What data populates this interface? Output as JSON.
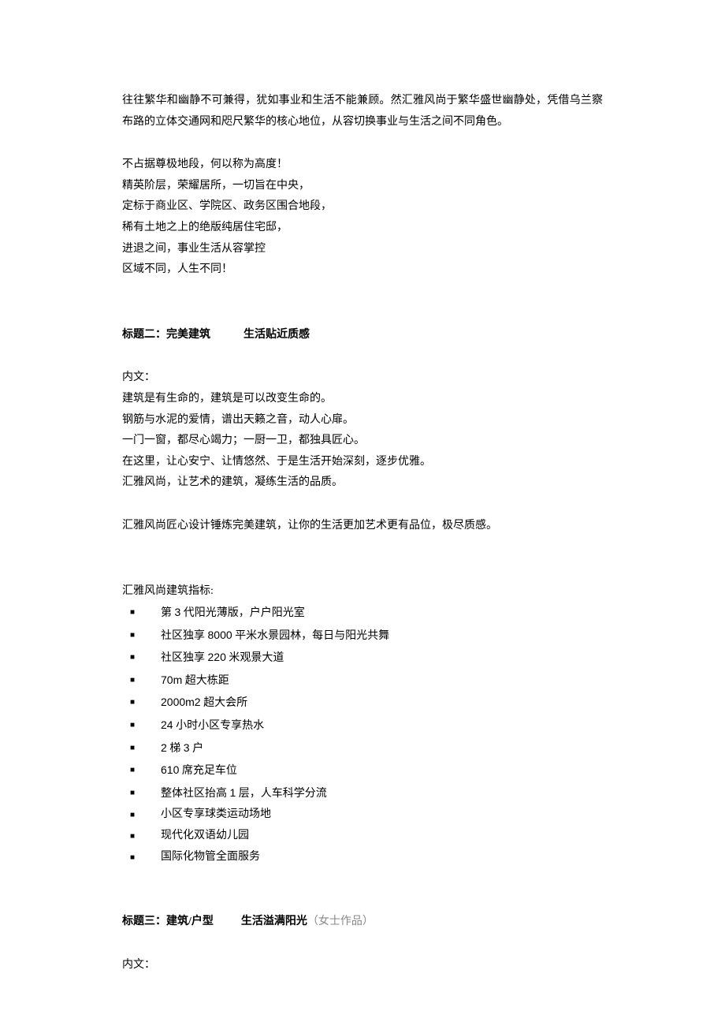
{
  "p1": "往往繁华和幽静不可兼得，犹如事业和生活不能兼顾。然汇雅风尚于繁华盛世幽静处，凭借乌兰察布路的立体交通网和咫尺繁华的核心地位，从容切换事业与生活之间不同角色。",
  "p2_lines": [
    "不占据尊极地段，何以称为高度！",
    "精英阶层，荣耀居所，一切旨在中央，",
    "定标于商业区、学院区、政务区围合地段，",
    "稀有土地之上的绝版纯居住宅邸，",
    "进退之间，事业生活从容掌控",
    "区域不同，人生不同！"
  ],
  "h2": {
    "prefix": "标题二：完美建筑",
    "suffix": "生活贴近质感"
  },
  "s2_lead": "内文：",
  "s2_lines": [
    "建筑是有生命的，建筑是可以改变生命的。",
    "钢筋与水泥的爱情，谱出天籁之音，动人心扉。",
    "一门一窗，都尽心竭力；一厨一卫，都独具匠心。",
    "在这里，让心安宁、让情悠然、于是生活开始深刻，逐步优雅。",
    "汇雅风尚，让艺术的建筑，凝练生活的品质。"
  ],
  "s2_p2": "汇雅风尚匠心设计锤炼完美建筑，让你的生活更加艺术更有品位，极尽质感。",
  "list_title": "汇雅风尚建筑指标:",
  "list_items": [
    {
      "pre": "第 ",
      "num": "3",
      "post": " 代阳光薄版，户户阳光室"
    },
    {
      "pre": "社区独享 ",
      "num": "8000",
      "post": " 平米水景园林，每日与阳光共舞"
    },
    {
      "pre": "社区独享 ",
      "num": "220",
      "post": " 米观景大道"
    },
    {
      "pre": "",
      "num": "70m",
      "post": " 超大栋距"
    },
    {
      "pre": "",
      "num": "2000m2",
      "post": " 超大会所"
    },
    {
      "pre": "",
      "num": "24",
      "post": " 小时小区专享热水"
    },
    {
      "pre": "",
      "num": "2",
      "mid": " 梯 ",
      "num2": "3",
      "post": " 户"
    },
    {
      "pre": "",
      "num": "610",
      "post": " 席充足车位"
    },
    {
      "pre": "整体社区抬高 ",
      "num": "1",
      "post": " 层，人车科学分流"
    },
    {
      "pre": "小区专享球类运动场地",
      "num": "",
      "post": ""
    },
    {
      "pre": "现代化双语幼儿园",
      "num": "",
      "post": ""
    },
    {
      "pre": "国际化物管全面服务",
      "num": "",
      "post": ""
    }
  ],
  "h3": {
    "prefix": "标题三：建筑/户型",
    "suffix": "生活溢满阳光",
    "note": "（女士作品）"
  },
  "s3_lead": "内文："
}
